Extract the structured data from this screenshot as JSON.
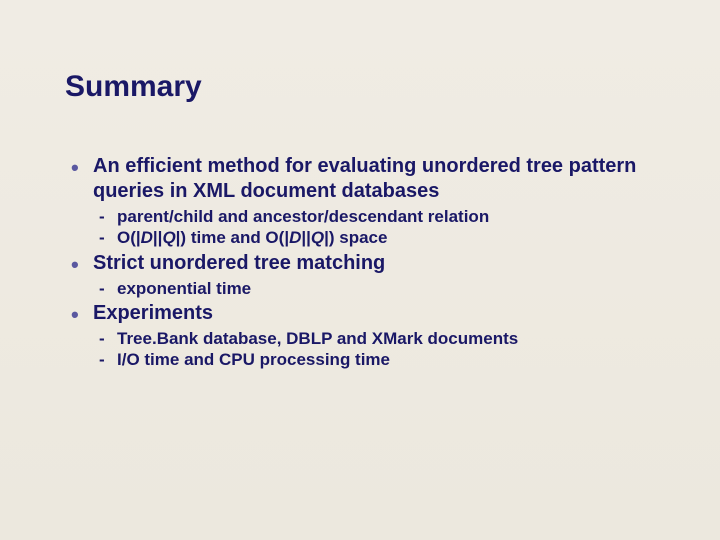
{
  "title": "Summary",
  "bullets": {
    "b1": "An efficient method for evaluating unordered tree pattern queries in XML document databases",
    "b1s1": "parent/child and ancestor/descendant  relation",
    "b1s2_prefix": "O(|",
    "b1s2_d1": "D",
    "b1s2_mid1": "||",
    "b1s2_q1": "Q",
    "b1s2_mid2": "|) time and O(|",
    "b1s2_d2": "D",
    "b1s2_mid3": "||",
    "b1s2_q2": "Q",
    "b1s2_suffix": "|) space",
    "b2": "Strict unordered tree matching",
    "b2s1": "exponential time",
    "b3": "Experiments",
    "b3s1": "Tree.Bank database, DBLP and XMark documents",
    "b3s2": "I/O time and CPU processing time"
  }
}
